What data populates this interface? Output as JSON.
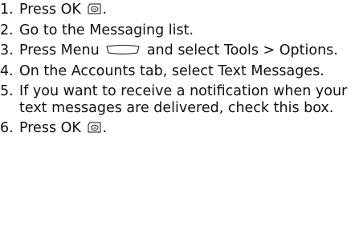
{
  "steps": [
    {
      "num": "1.",
      "text_before": "Press OK",
      "icon": "ok-key-icon",
      "text_after": "."
    },
    {
      "num": "2.",
      "text": "Go to the Messaging list."
    },
    {
      "num": "3.",
      "text_before": "Press Menu",
      "icon": "menu-softkey-icon",
      "text_after": "and select Tools > Options."
    },
    {
      "num": "4.",
      "text": "On the Accounts tab, select Text Messages."
    },
    {
      "num": "5.",
      "text": "If you want to receive a notification when your text messages are delivered, check this box."
    },
    {
      "num": "6.",
      "text_before": "Press OK",
      "icon": "ok-key-icon",
      "text_after": "."
    }
  ]
}
